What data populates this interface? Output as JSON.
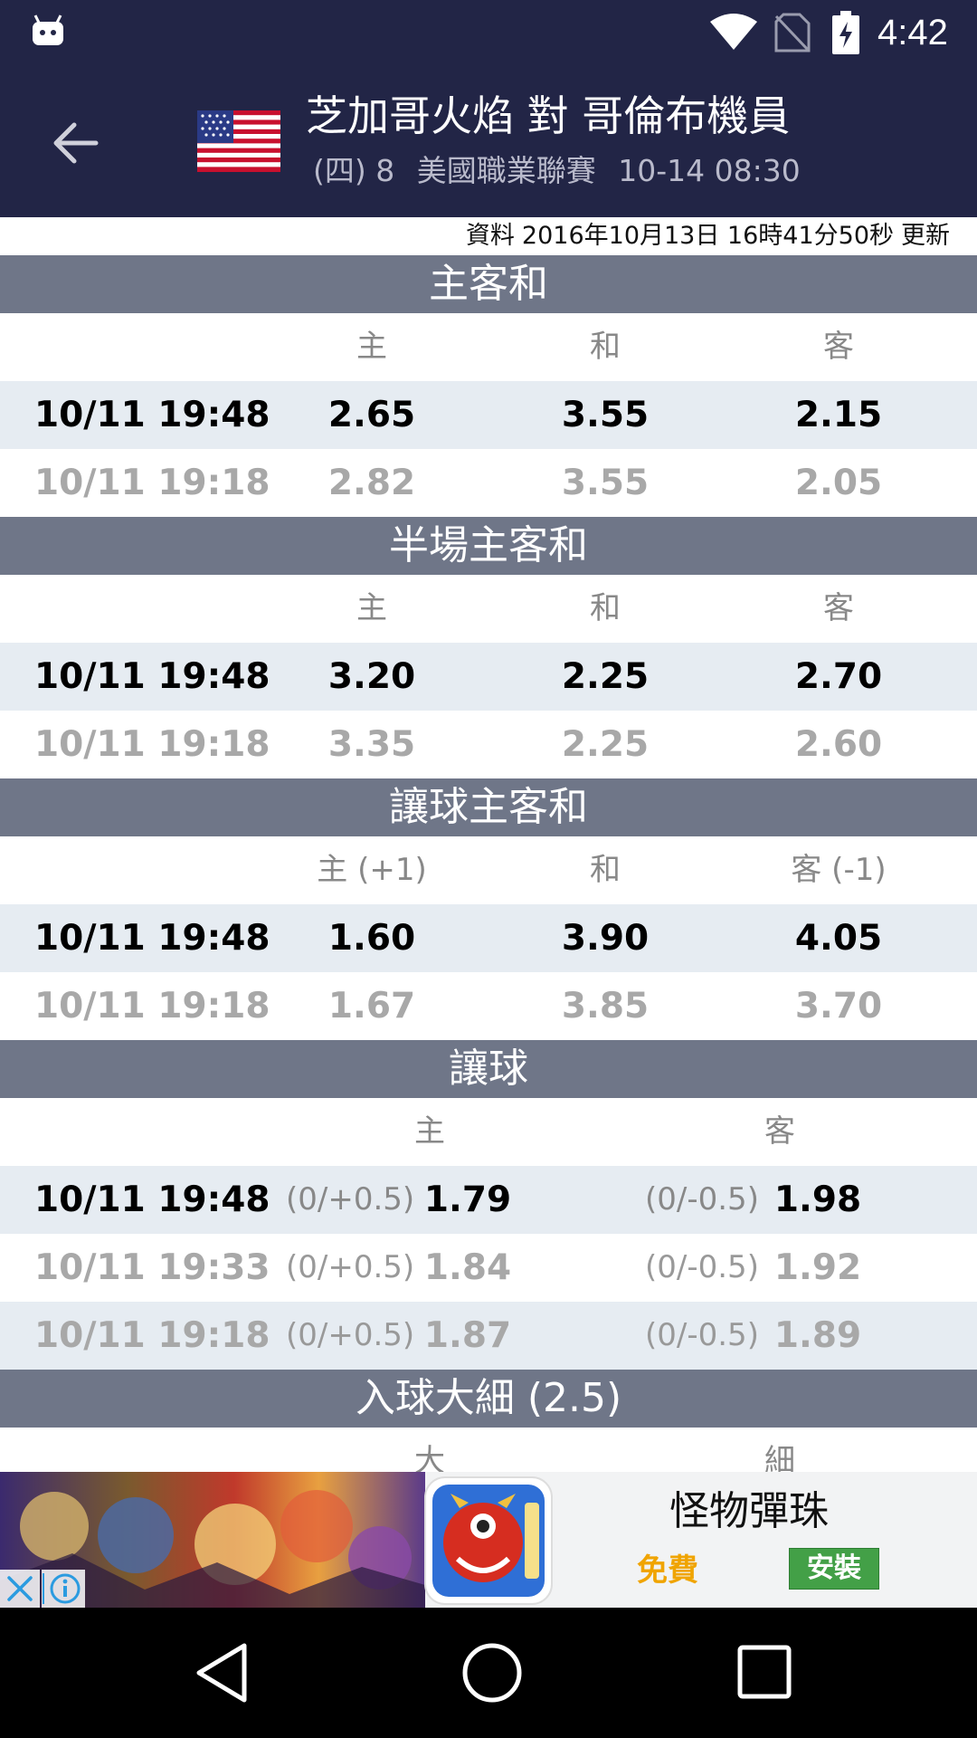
{
  "status_bar": {
    "time": "4:42",
    "icons": [
      "android-notification-icon",
      "wifi-icon",
      "no-sim-icon",
      "battery-charging-icon"
    ]
  },
  "toolbar": {
    "back_icon": "arrow-left-icon",
    "flag_icon": "usa-flag-icon",
    "title": "芝加哥火焰 對 哥倫布機員",
    "sub_day": "(四) 8",
    "sub_league": "美國職業聯賽",
    "sub_datetime": "10-14 08:30"
  },
  "update": {
    "prefix": "資料",
    "datetime": "2016年10月13日 16時41分50秒",
    "suffix": "更新"
  },
  "sections": {
    "hda": {
      "title": "主客和",
      "cols": [
        "主",
        "和",
        "客"
      ],
      "rows": [
        {
          "time": "10/11 19:48",
          "home": "2.65",
          "draw": "3.55",
          "away": "2.15"
        },
        {
          "time": "10/11 19:18",
          "home": "2.82",
          "draw": "3.55",
          "away": "2.05"
        }
      ]
    },
    "half": {
      "title": "半場主客和",
      "cols": [
        "主",
        "和",
        "客"
      ],
      "rows": [
        {
          "time": "10/11 19:48",
          "home": "3.20",
          "draw": "2.25",
          "away": "2.70"
        },
        {
          "time": "10/11 19:18",
          "home": "3.35",
          "draw": "2.25",
          "away": "2.60"
        }
      ]
    },
    "hhad": {
      "title": "讓球主客和",
      "cols": [
        "主 (+1)",
        "和",
        "客 (-1)"
      ],
      "rows": [
        {
          "time": "10/11 19:48",
          "home": "1.60",
          "draw": "3.90",
          "away": "4.05"
        },
        {
          "time": "10/11 19:18",
          "home": "1.67",
          "draw": "3.85",
          "away": "3.70"
        }
      ]
    },
    "handicap": {
      "title": "讓球",
      "cols": [
        "主",
        "客"
      ],
      "rows": [
        {
          "time": "10/11 19:48",
          "home_line": "(0/+0.5)",
          "home": "1.79",
          "away_line": "(0/-0.5)",
          "away": "1.98"
        },
        {
          "time": "10/11 19:33",
          "home_line": "(0/+0.5)",
          "home": "1.84",
          "away_line": "(0/-0.5)",
          "away": "1.92"
        },
        {
          "time": "10/11 19:18",
          "home_line": "(0/+0.5)",
          "home": "1.87",
          "away_line": "(0/-0.5)",
          "away": "1.89"
        }
      ]
    },
    "goals": {
      "title": "入球大細 (2.5)",
      "cols": [
        "大",
        "細"
      ]
    }
  },
  "ad": {
    "title": "怪物彈珠",
    "free": "免費",
    "install": "安裝",
    "icons": [
      "close-icon",
      "info-icon"
    ]
  },
  "nav_bar": {
    "icons": [
      "nav-back-icon",
      "nav-home-icon",
      "nav-recents-icon"
    ]
  },
  "colors": {
    "header_bg": "#222546",
    "section_bg": "#6f7688",
    "row_highlight": "#e6ecf2",
    "ad_install": "#43a047",
    "ad_free": "#f0a400"
  }
}
